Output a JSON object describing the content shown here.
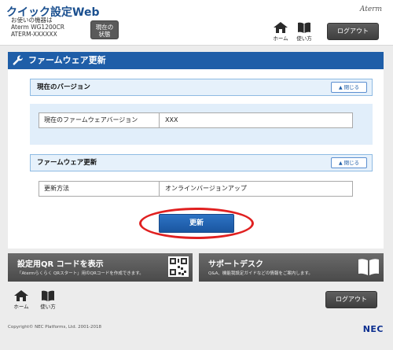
{
  "header": {
    "app_title": "クイック設定Web",
    "device_label": "お使いの機器は",
    "device_model": "Aterm WG1200CR",
    "device_id": "ATERM-XXXXXX",
    "status_button_line1": "現在の",
    "status_button_line2": "状態",
    "brand": "Aterm",
    "home_label": "ホーム",
    "manual_label": "使い方",
    "logout_label": "ログアウト"
  },
  "page": {
    "title": "ファームウェア更新"
  },
  "current_version_section": {
    "heading": "現在のバージョン",
    "close_label": "閉じる",
    "row_label": "現在のファームウェアバージョン",
    "row_value": "XXX"
  },
  "firmware_update_section": {
    "heading": "ファームウェア更新",
    "close_label": "閉じる",
    "row_label": "更新方法",
    "row_value": "オンラインバージョンアップ"
  },
  "update_button_label": "更新",
  "banners": {
    "qr_title": "設定用QR コードを表示",
    "qr_desc": "「Atermらくらく QRスタート」用のQRコードを作成できます。",
    "support_title": "サポートデスク",
    "support_desc": "Q&A、機能我設定ガイドなどの情報をご案内します。"
  },
  "footer": {
    "home_label": "ホーム",
    "manual_label": "使い方",
    "logout_label": "ログアウト",
    "copyright": "Copyright© NEC Platforms, Ltd. 2001-2018",
    "company_logo": "NEC"
  },
  "colors": {
    "title_bar": "#1f5ea8",
    "section_head": "#e6f1fb",
    "section_body": "#e1eefa",
    "highlight_ring": "#e02020"
  }
}
